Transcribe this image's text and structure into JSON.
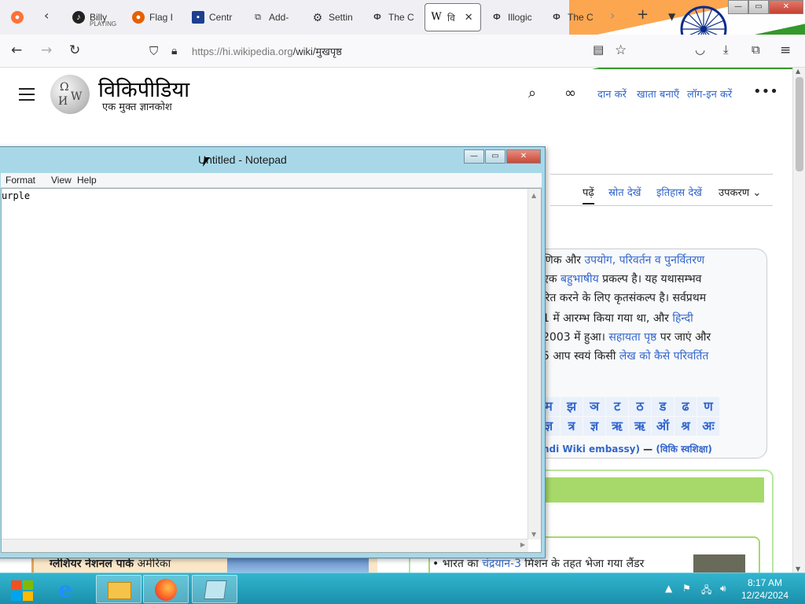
{
  "browser": {
    "tabs": [
      {
        "label": "Billy",
        "sub": "PLAYING"
      },
      {
        "label": "Flag I"
      },
      {
        "label": "Centr"
      },
      {
        "label": "Add-"
      },
      {
        "label": "Settin"
      },
      {
        "label": "The C"
      },
      {
        "label": "वि",
        "active": true
      },
      {
        "label": "Illogic"
      },
      {
        "label": "The C"
      }
    ],
    "url_main": "https://hi.wikipedia.org",
    "url_path": "/wiki/मुखपृष्ठ"
  },
  "wiki": {
    "title": "विकिपीडिया",
    "tagline": "एक मुक्त ज्ञानकोश",
    "header_links": [
      "दान करें",
      "खाता बनाएँ",
      "लॉग-इन करें"
    ],
    "page_tabs": [
      "पढ़ें",
      "स्रोत देखें",
      "इतिहास देखें",
      "उपकरण"
    ],
    "intro": {
      "l1a": "णिक और ",
      "l1b": "उपयोग, परिवर्तन व पुनर्वितरण",
      "l2a": " एक ",
      "l2b": "बहुभाषीय",
      "l2c": " प्रकल्प है। यह यथासम्भव",
      "l3": "रित करने के लिए कृतसंकल्प है। सर्वप्रथम",
      "l4a": "1 में आरम्भ किया गया था, और ",
      "l4b": "हिन्दी",
      "l5a": "2003 में हुआ। ",
      "l5b": "सहायता पृष्ठ",
      "l5c": " पर जाएं और",
      "l6a": "5 आप स्वयं किसी ",
      "l6b": "लेख को कैसे परिवर्तित"
    },
    "alphabet": [
      "म",
      "झ",
      "ञ",
      "ट",
      "ठ",
      "ड",
      "ढ",
      "ण",
      "ज्ञ",
      "त्र",
      "ज्ञ",
      "ऋ",
      "ऋ",
      "ऑ",
      "श्र",
      "अः"
    ],
    "embassy_a": "ndi Wiki embassy)",
    "embassy_b": " — ",
    "embassy_c": "(विकि स्वशिक्षा)",
    "news_a": "भारत का ",
    "news_b": "चंद्रयान-3",
    "news_c": " मिशन के तहत भेजा गया लैंडर",
    "featured_a": "ग्लेशियर नेशनल पार्क",
    "featured_b": " अमेरिका"
  },
  "notepad": {
    "title": "Untitled - Notepad",
    "menu": [
      "Format",
      "View",
      "Help"
    ],
    "content": "urple"
  },
  "taskbar": {
    "time": "8:17 AM",
    "date": "12/24/2024"
  },
  "colors": {
    "link": "#3366cc",
    "taskbar": "#1b8fab",
    "notepad_frame": "#a8d8e8"
  }
}
